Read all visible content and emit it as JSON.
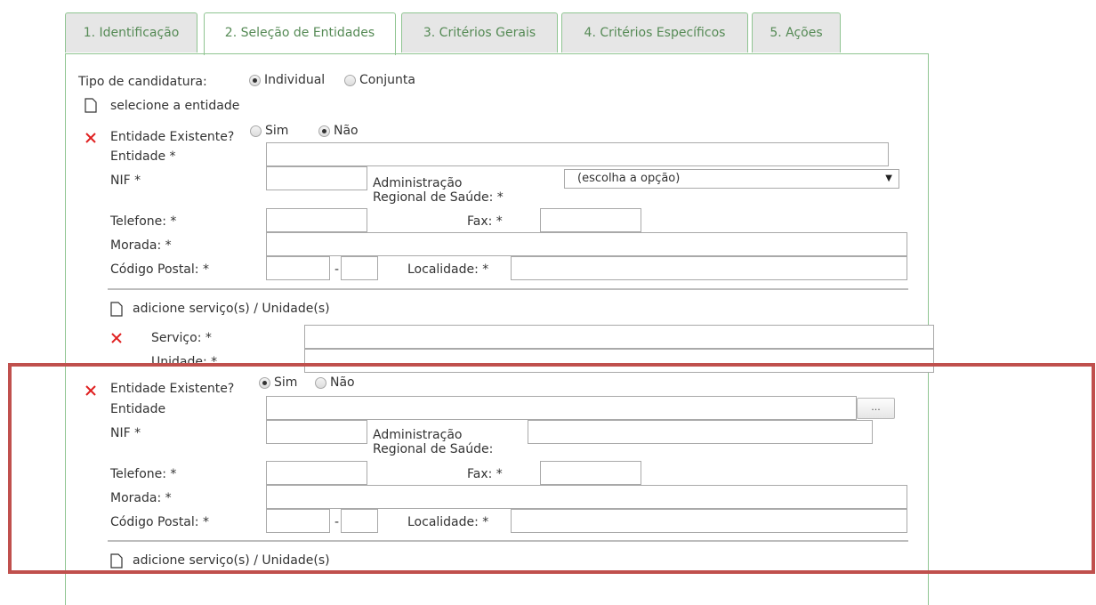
{
  "tabs": [
    {
      "label": "1. Identificação"
    },
    {
      "label": "2. Seleção de Entidades"
    },
    {
      "label": "3. Critérios Gerais"
    },
    {
      "label": "4. Critérios Específicos"
    },
    {
      "label": "5. Ações"
    }
  ],
  "active_tab": "2. Seleção de Entidades",
  "candidatura": {
    "label": "Tipo de candidatura:",
    "option_individual": "Individual",
    "option_conjunta": "Conjunta",
    "selected": "Individual"
  },
  "select_entity_label": "selecione a entidade",
  "entity1": {
    "existente_label": "Entidade Existente?",
    "opt_sim": "Sim",
    "opt_nao": "Não",
    "selected": "Não",
    "entidade_label": "Entidade *",
    "nif_label": "NIF *",
    "ars_label_line1": "Administração",
    "ars_label_line2": "Regional de Saúde: *",
    "ars_select_value": "(escolha a opção)",
    "telefone_label": "Telefone: *",
    "fax_label": "Fax: *",
    "morada_label": "Morada: *",
    "codigo_postal_label": "Código Postal: *",
    "cp_separator": "-",
    "localidade_label": "Localidade: *",
    "add_service_label": "adicione serviço(s) / Unidade(s)",
    "servico_label": "Serviço: *",
    "unidade_label": "Unidade: *"
  },
  "entity2": {
    "existente_label": "Entidade Existente?",
    "opt_sim": "Sim",
    "opt_nao": "Não",
    "selected": "Sim",
    "entidade_label": "Entidade",
    "browse_label": "...",
    "nif_label": "NIF *",
    "ars_label_line1": "Administração",
    "ars_label_line2": "Regional de Saúde:",
    "telefone_label": "Telefone: *",
    "fax_label": "Fax: *",
    "morada_label": "Morada: *",
    "codigo_postal_label": "Código Postal: *",
    "cp_separator": "-",
    "localidade_label": "Localidade: *",
    "add_service_label": "adicione serviço(s) / Unidade(s)"
  },
  "colors": {
    "tab_border": "#8fc491",
    "tab_text": "#558a55",
    "remove_icon": "#e02020",
    "highlight": "#c0504d"
  }
}
